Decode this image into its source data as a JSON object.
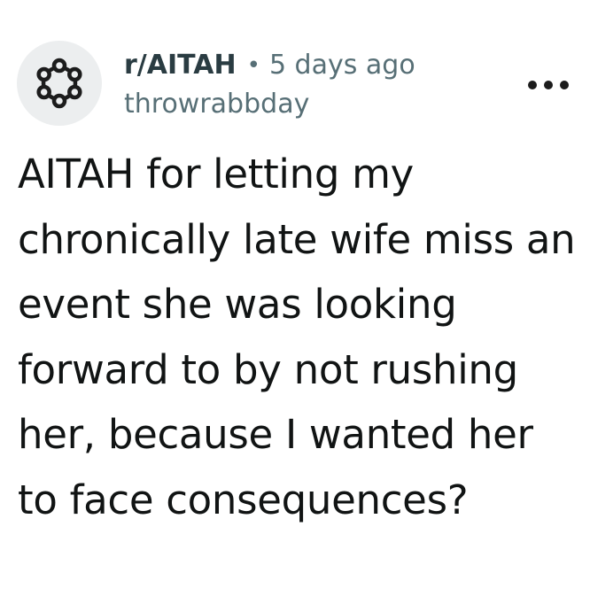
{
  "post": {
    "subreddit": "r/AITAH",
    "separator": "•",
    "time_ago": "5 days ago",
    "username": "throwrabbday",
    "title": "AITAH for letting my chronically late wife miss an event she was looking forward to by not rushing her, because I wanted her to face consequences?"
  },
  "icons": {
    "avatar": "subreddit-ring-icon",
    "more": "ellipsis-icon"
  },
  "colors": {
    "text_primary": "#1c1c1c",
    "text_secondary": "#576f76",
    "avatar_bg": "#eceeef"
  }
}
